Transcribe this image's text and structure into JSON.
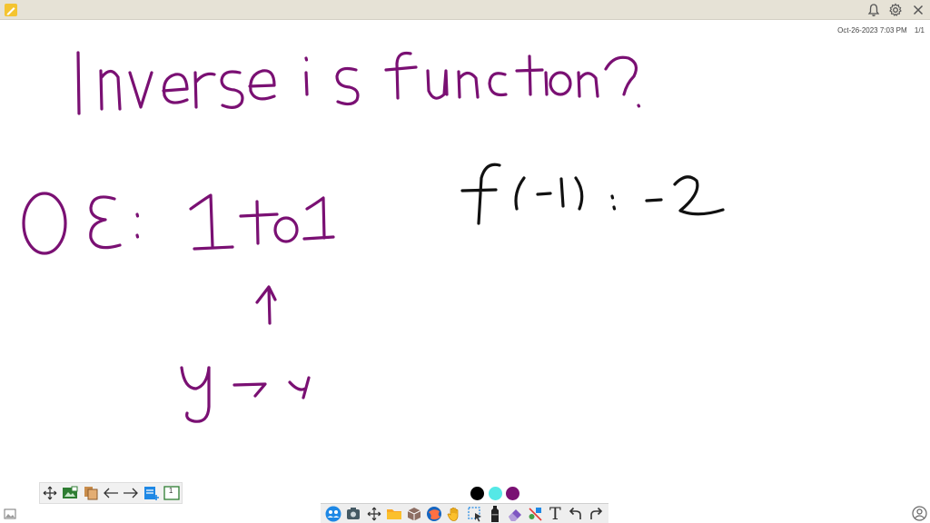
{
  "header": {
    "app_icon": "pencil-app-icon",
    "icons": [
      "bell-icon",
      "gear-icon",
      "close-icon"
    ]
  },
  "page_info": {
    "timestamp": "Oct-26-2023 7:03 PM",
    "page": "1/1"
  },
  "board": {
    "ink_colors": {
      "purple": "#7a1073",
      "black": "#111111"
    },
    "handwriting": [
      "Inverse is function?",
      "OE: 1to1",
      "y → x",
      "f(-1) = -2"
    ]
  },
  "left_toolbar": {
    "icons": [
      "move-icon",
      "image-icon",
      "copy-pages-icon",
      "back-arrow-icon",
      "forward-arrow-icon",
      "add-page-icon",
      "page-number-icon"
    ],
    "page_number": "1"
  },
  "colors": {
    "swatches": [
      "#000000",
      "#55e8e6",
      "#7a1073"
    ]
  },
  "bottom_toolbar": {
    "icons": [
      "users-icon",
      "screenshot-icon",
      "move-icon",
      "folder-icon",
      "3d-box-icon",
      "browser-icon",
      "hand-icon",
      "select-icon",
      "marker-icon",
      "eraser-icon",
      "shapes-icon",
      "text-icon",
      "undo-icon",
      "redo-icon"
    ],
    "text_tool_label": "T"
  }
}
